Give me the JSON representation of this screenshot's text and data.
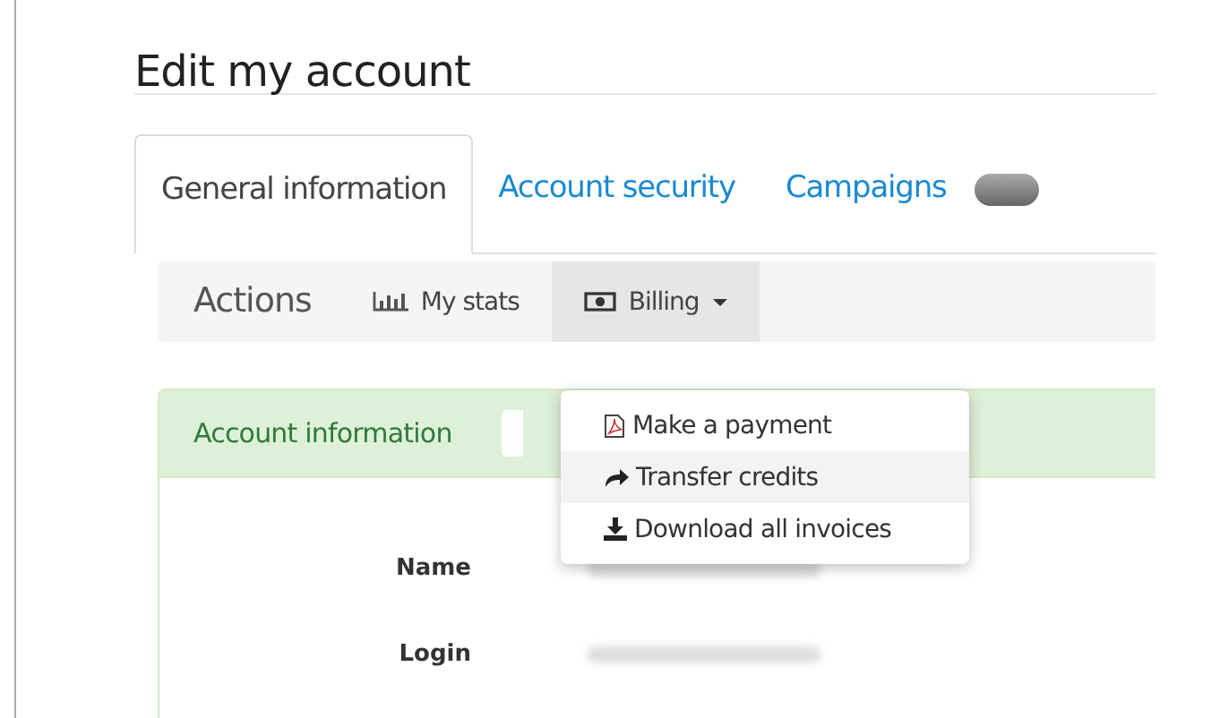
{
  "page": {
    "title": "Edit my account"
  },
  "tabs": [
    {
      "label": "General information",
      "selected": true
    },
    {
      "label": "Account security",
      "selected": false
    },
    {
      "label": "Campaigns",
      "selected": false,
      "kind": "toggle",
      "on": false
    }
  ],
  "actions": {
    "label": "Actions",
    "items": [
      {
        "label": "My stats",
        "selected": false,
        "kind": "link"
      },
      {
        "label": "Billing",
        "selected": true,
        "kind": "dropdown"
      }
    ]
  },
  "dropdown_menu": [
    {
      "label": "Make a payment",
      "selected": false
    },
    {
      "label": "Transfer credits",
      "selected": true
    },
    {
      "label": "Download all invoices",
      "selected": false
    }
  ],
  "panel": {
    "title": "Account information",
    "fields": [
      {
        "label": "Name"
      },
      {
        "label": "Login"
      }
    ]
  }
}
